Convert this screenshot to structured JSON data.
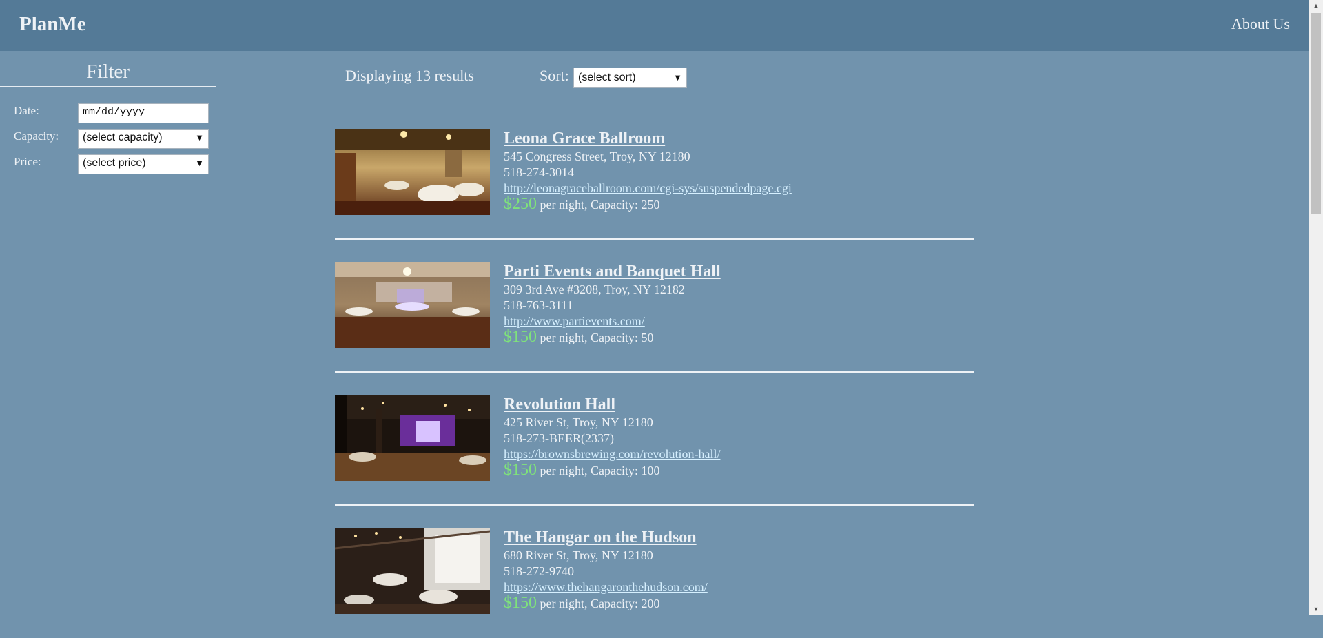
{
  "navbar": {
    "brand": "PlanMe",
    "about": "About Us"
  },
  "filter": {
    "title": "Filter",
    "date_label": "Date:",
    "date_placeholder": "mm/dd/yyyy",
    "capacity_label": "Capacity:",
    "capacity_value": "(select capacity)",
    "price_label": "Price:",
    "price_value": "(select price)"
  },
  "results": {
    "count_text": "Displaying 13 results",
    "sort_label": "Sort:",
    "sort_value": "(select sort)"
  },
  "listings": [
    {
      "name": "Leona Grace Ballroom",
      "address": "545 Congress Street, Troy, NY 12180",
      "phone": "518-274-3014",
      "url": "http://leonagraceballroom.com/cgi-sys/suspendedpage.cgi",
      "price": "$250",
      "details": "per night, Capacity: 250"
    },
    {
      "name": "Parti Events and Banquet Hall",
      "address": "309 3rd Ave #3208, Troy, NY 12182",
      "phone": "518-763-3111",
      "url": "http://www.partievents.com/",
      "price": "$150",
      "details": "per night, Capacity: 50"
    },
    {
      "name": "Revolution Hall",
      "address": "425 River St, Troy, NY 12180",
      "phone": "518-273-BEER(2337)",
      "url": "https://brownsbrewing.com/revolution-hall/",
      "price": "$150",
      "details": "per night, Capacity: 100"
    },
    {
      "name": "The Hangar on the Hudson",
      "address": "680 River St, Troy, NY 12180",
      "phone": "518-272-9740",
      "url": "https://www.thehangaronthehudson.com/",
      "price": "$150",
      "details": "per night, Capacity: 200"
    }
  ],
  "colors": {
    "page_bg": "#7193ad",
    "navbar_bg": "#547a97",
    "price": "#7fe37a",
    "link": "#d6f0ff"
  }
}
